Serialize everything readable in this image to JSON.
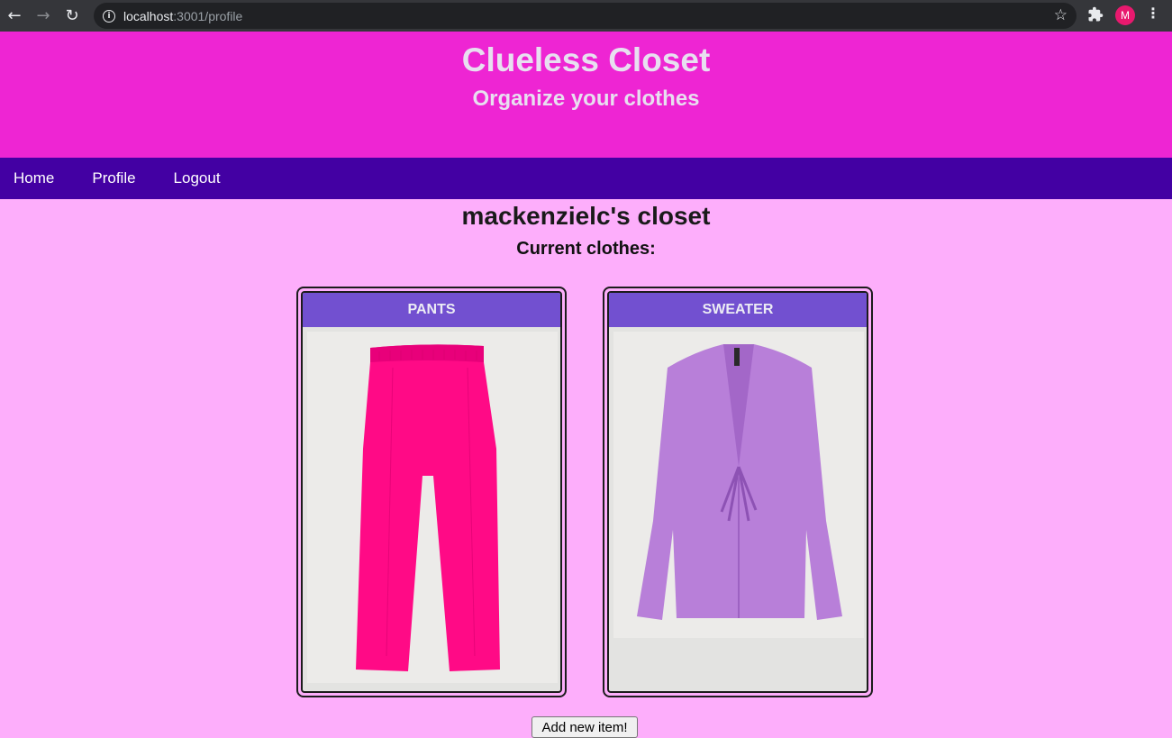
{
  "browser": {
    "url_host": "localhost",
    "url_path": ":3001/profile",
    "profile_initial": "M"
  },
  "header": {
    "title": "Clueless Closet",
    "tagline": "Organize your clothes"
  },
  "nav": {
    "items": [
      "Home",
      "Profile",
      "Logout"
    ]
  },
  "main": {
    "title": "mackenzielc's closet",
    "section_heading": "Current clothes:",
    "items": [
      {
        "label": "PANTS",
        "color": "#ff0a86"
      },
      {
        "label": "SWEATER",
        "color": "#b87fd9"
      }
    ],
    "add_button": "Add new item!"
  },
  "colors": {
    "header_bg": "#ee25d3",
    "nav_bg": "#4300a3",
    "page_bg": "#fdaefb",
    "card_header_bg": "#7250d0"
  }
}
